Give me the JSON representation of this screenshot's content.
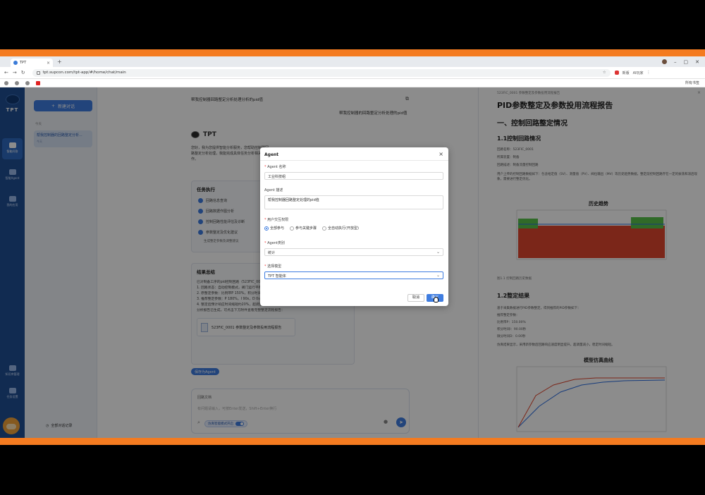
{
  "browser": {
    "tab_title": "TPT",
    "url": "tpt.supcon.com/tpt-app/#/home/chat/main",
    "ext_label_1": "新版",
    "ext_label_2": "AI玩家",
    "bookmarks_right": "所有书签"
  },
  "rail": {
    "logo_text": "TPT",
    "items": [
      {
        "label": "智能问答"
      },
      {
        "label": "智能Agent"
      },
      {
        "label": "我的应用"
      },
      {
        "label": "知识库管理"
      },
      {
        "label": "任务设置"
      }
    ]
  },
  "sidebar": {
    "new_chat_label": "新建对话",
    "group_label": "今天",
    "conversation_title": "帮我控制器的回路整定分析...",
    "conversation_date": "今天",
    "footer_label": "全部对话记录"
  },
  "chat": {
    "title": "帮我控制器回路整定分析处理分析的pid值",
    "user_message": "帮我控制器的回路整定分析处理的pid值",
    "bot_name": "TPT",
    "greeting": "您好，我为您提供智能分析服务，您帮助控制器回路整定分析处理，我能完成具体任务分析相关工作。",
    "task_title": "任务执行",
    "steps": [
      "回路信息查询",
      "回路数据作图分析",
      "控制回路性能评估及诊断",
      "参数整定及优化建议"
    ],
    "substep": "生成整定参数及调整建议",
    "result_title": "结果总结",
    "result_lines": [
      "已对制备工序的pid控制回路（523FIC_0001）完成整定分析和参数优化：",
      "1. 回路状态：自动控制模式，阀门运行平稳无波动",
      "2. 原整定参数：比例带P 150%，积分时间120s，微分0s",
      "3. 推荐整定参数：P 180%，I 90s，D 0s（需工程师确认）",
      "4. 整定后预计响应时间缩短约20%，超调量控制在5%以内",
      "分析报告已生成，可点击下方附件查看完整整定流程报告："
    ],
    "file_name": "523FIC_0001 参数整定及参数投用流程报告",
    "save_agent_label": "保存为Agent",
    "input_file": "回路文档",
    "input_placeholder": "有问题请输入，可按Enter发送，Shift+Enter换行",
    "mode_pill": "仿真智能模式开启"
  },
  "report": {
    "breadcrumb": "523FIC_0001 参数整定及参数投用流程报告",
    "h1": "PID参数整定及参数投用流程报告",
    "h2": "一、控制回路整定情况",
    "s11": "1.1控制回路情况",
    "s11_lines": [
      "回路名称：523FIC_0001",
      "所属装置：制备",
      "回路描述：制备流量控制回路",
      "用户上传的控制回路数据如下：包含给定值（SV）、测量值（PV）、阀位输出（MV）等历史趋势数据，整定前控制回路存在一定的振荡和滞后现象，需要进行整定优化。"
    ],
    "chart1_title": "历史趋势",
    "chart1_caption": "图1.1 控制回路历史数据",
    "s12": "1.2整定结果",
    "s12_lines": [
      "基于采集数据进行PID参数整定，得到推荐的PID参数如下：",
      "推荐整定参数：",
      "比例带P：150.00%",
      "积分时间I：90.00秒",
      "微分时间D：0.00秒",
      "仿真结果显示，采用新参数后回路响应速度明显提升，超调量减小，稳定时间缩短。"
    ],
    "chart2_title": "模型仿真曲线"
  },
  "dialog": {
    "title": "Agent",
    "name_label": "Agent 名称",
    "name_value": "工业科技组",
    "desc_label": "Agent 描述",
    "desc_value": "帮我控制器回路整定处理的pid值",
    "permission_label": "用户交互权限",
    "permission_options": [
      "全部参与",
      "参与关键步骤",
      "全自动执行(开放型)"
    ],
    "permission_selected": "全部参与",
    "category_label": "Agent类别",
    "category_value": "统计",
    "model_label": "选择模型",
    "model_value": "TPT 智能体",
    "cancel_label": "取消",
    "confirm_label": "确定"
  },
  "colors": {
    "accent": "#3f7de0",
    "rail": "#1f4f94",
    "frame": "#f47b20"
  }
}
